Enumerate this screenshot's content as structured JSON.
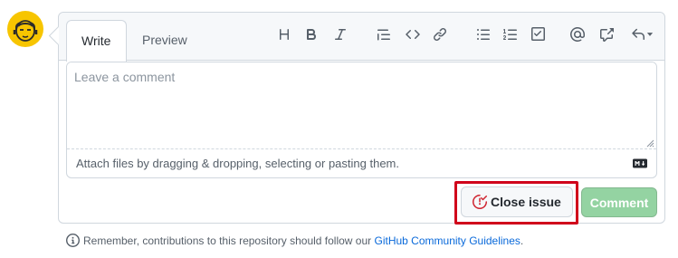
{
  "tabs": {
    "write": "Write",
    "preview": "Preview"
  },
  "toolbar": {
    "heading_label": "H",
    "bold_label": "B",
    "italic_label": "I"
  },
  "editor": {
    "placeholder": "Leave a comment",
    "attach_text": "Attach files by dragging & dropping, selecting or pasting them."
  },
  "actions": {
    "close_issue": "Close issue",
    "comment": "Comment"
  },
  "footer": {
    "prefix": "Remember, contributions to this repository should follow our ",
    "link": "GitHub Community Guidelines",
    "suffix": "."
  },
  "colors": {
    "highlight": "#d0021b",
    "comment_button": "#94d3a2",
    "link": "#0969da",
    "close_icon": "#cf222e"
  }
}
